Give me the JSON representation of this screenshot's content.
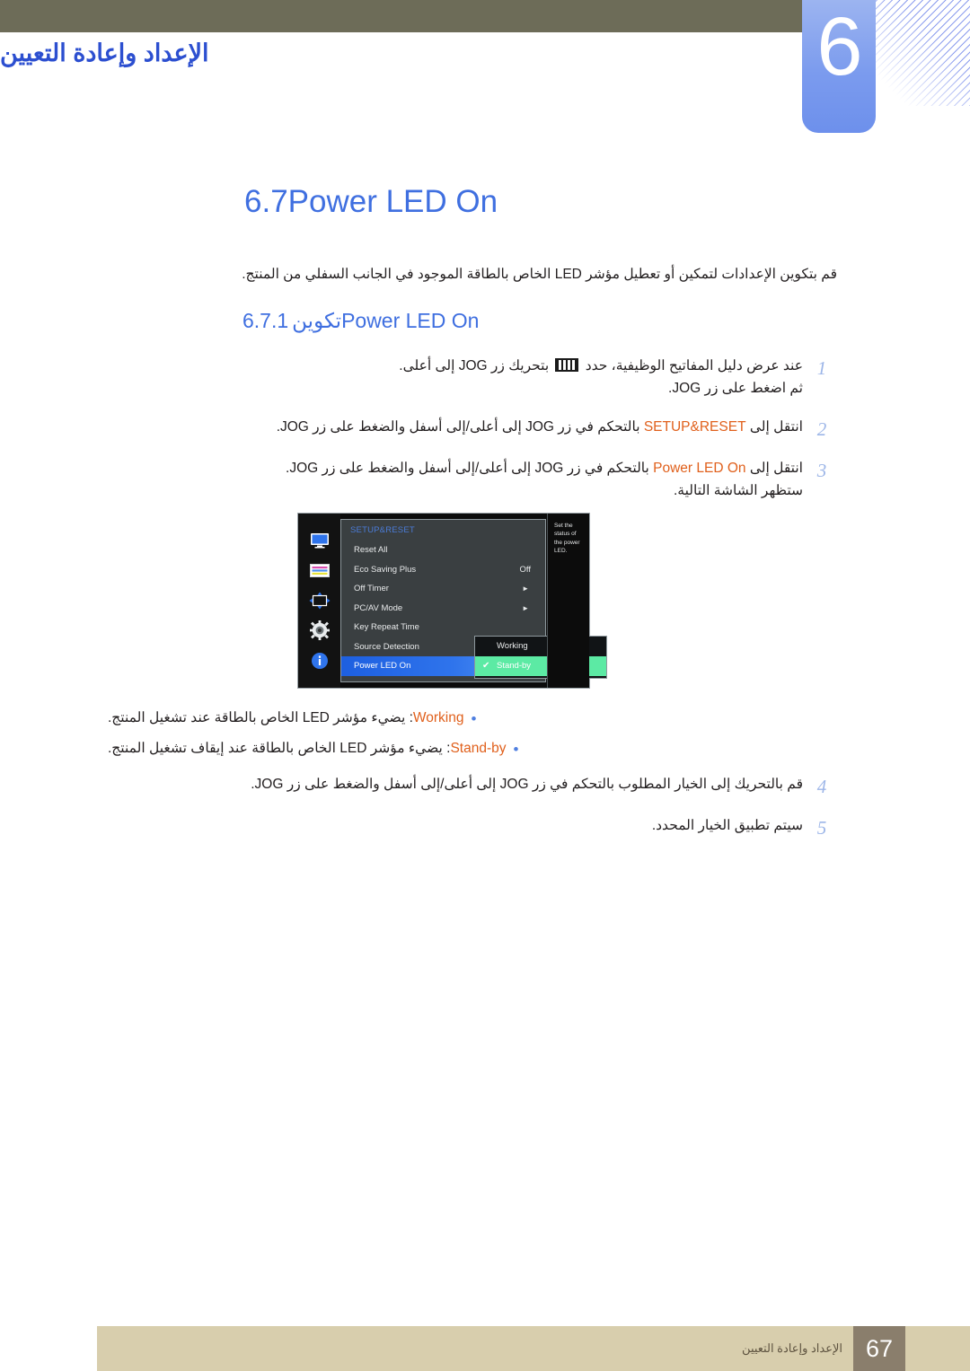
{
  "chapter": {
    "number": "6",
    "title": "الإعداد وإعادة التعيين"
  },
  "section": {
    "number": "6.7",
    "title": "Power LED On",
    "intro": "قم بتكوين الإعدادات لتمكين أو تعطيل مؤشر LED الخاص بالطاقة الموجود في الجانب السفلي من المنتج.",
    "sub_number": "6.7.1",
    "sub_title_en": "Power LED On",
    "sub_title_ar": "تكوين"
  },
  "steps": [
    {
      "num": "1",
      "line1_pre": "عند عرض دليل المفاتيح الوظيفية، حدد ",
      "line1_icon": "jog-guide-icon",
      "line1_post": " بتحريك زر JOG إلى أعلى.",
      "line2": "ثم اضغط على زر JOG."
    },
    {
      "num": "2",
      "pre": "انتقل إلى ",
      "keyword": "SETUP&RESET",
      "post": " بالتحكم في زر JOG إلى أعلى/إلى أسفل والضغط على زر JOG."
    },
    {
      "num": "3",
      "pre": "انتقل إلى ",
      "keyword": "Power LED On",
      "post": " بالتحكم في زر JOG إلى أعلى/إلى أسفل والضغط على زر JOG.",
      "line2": "ستظهر الشاشة التالية."
    },
    {
      "num": "4",
      "text": "قم بالتحريك إلى الخيار المطلوب بالتحكم في زر JOG إلى أعلى/إلى أسفل والضغط على زر JOG."
    },
    {
      "num": "5",
      "text": "سيتم تطبيق الخيار المحدد."
    }
  ],
  "bullets": [
    {
      "dot": "•",
      "keyword": "Working",
      "text": ": يضيء مؤشر LED الخاص بالطاقة عند تشغيل المنتج."
    },
    {
      "dot": "•",
      "keyword": "Stand-by",
      "text": ": يضيء مؤشر LED الخاص بالطاقة عند إيقاف تشغيل المنتج."
    }
  ],
  "osd": {
    "menu_title": "SETUP&RESET",
    "rows": [
      {
        "label": "Reset All",
        "value": "",
        "arrow": false
      },
      {
        "label": "Eco Saving Plus",
        "value": "Off",
        "arrow": false
      },
      {
        "label": "Off Timer",
        "value": "",
        "arrow": true
      },
      {
        "label": "PC/AV Mode",
        "value": "",
        "arrow": true
      },
      {
        "label": "Key Repeat Time",
        "value": "",
        "arrow": false
      },
      {
        "label": "Source Detection",
        "value": "",
        "arrow": false
      },
      {
        "label": "Power LED On",
        "value": "",
        "arrow": false,
        "selected": true
      }
    ],
    "popup_options": [
      {
        "label": "Working",
        "checked": false
      },
      {
        "label": "Stand-by",
        "checked": true,
        "check": "✔"
      }
    ],
    "help_text": "Set the status of the power LED.",
    "icons": [
      "monitor-icon",
      "color-bars-icon",
      "size-position-icon",
      "gear-icon",
      "info-icon"
    ],
    "arrow_glyph": "►",
    "colors": {
      "selected_row": "#2f74ec",
      "active_option": "#5ceaa4",
      "menu_title": "#4a7bd6"
    }
  },
  "footer": {
    "page": "67",
    "label": "الإعداد وإعادة التعيين"
  },
  "colors": {
    "accent_blue": "#3f6fe0",
    "keyword_orange": "#e0601c",
    "olive": "#6d6c58",
    "footer_tan": "#d8cead",
    "footer_brown": "#8a7e6c"
  }
}
